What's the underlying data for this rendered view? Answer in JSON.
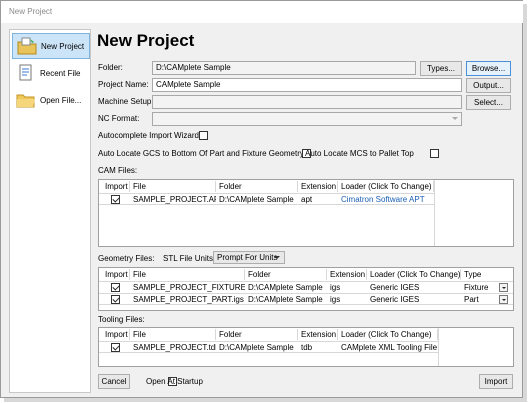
{
  "window": {
    "title": "New Project"
  },
  "sidebar": {
    "items": [
      {
        "label": "New Project"
      },
      {
        "label": "Recent File"
      },
      {
        "label": "Open File..."
      }
    ]
  },
  "page": {
    "heading": "New Project"
  },
  "form": {
    "folder_label": "Folder:",
    "folder_value": "D:\\CAMplete Sample",
    "types_button": "Types...",
    "browse_button": "Browse...",
    "project_name_label": "Project Name:",
    "project_name_value": "CAMplete Sample",
    "output_button": "Output...",
    "machine_setup_label": "Machine Setup:",
    "machine_setup_value": "",
    "select_button": "Select...",
    "nc_format_label": "NC Format:",
    "nc_format_value": "",
    "autocomplete_label": "Autocomplete Import Wizard",
    "auto_gcs_label": "Auto Locate GCS to Bottom Of Part and Fixture Geometry",
    "auto_mcs_label": "Auto Locate MCS to Pallet Top"
  },
  "cam": {
    "title": "CAM Files:",
    "headers": [
      "Import",
      "File",
      "Folder",
      "Extension",
      "Loader (Click To Change)"
    ],
    "rows": [
      {
        "file": "SAMPLE_PROJECT.APT",
        "folder": "D:\\CAMplete Sample",
        "ext": "apt",
        "loader": "Cimatron Software APT"
      }
    ]
  },
  "geometry": {
    "title": "Geometry Files:",
    "stl_label": "STL File Units:",
    "stl_value": "Prompt For Units",
    "headers": [
      "Import",
      "File",
      "Folder",
      "Extension",
      "Loader (Click To Change)",
      "Type"
    ],
    "rows": [
      {
        "file": "SAMPLE_PROJECT_FIXTURE.igs",
        "folder": "D:\\CAMplete Sample",
        "ext": "igs",
        "loader": "Generic IGES",
        "type": "Fixture"
      },
      {
        "file": "SAMPLE_PROJECT_PART.igs",
        "folder": "D:\\CAMplete Sample",
        "ext": "igs",
        "loader": "Generic IGES",
        "type": "Part"
      }
    ]
  },
  "tooling": {
    "title": "Tooling Files:",
    "headers": [
      "Import",
      "File",
      "Folder",
      "Extension",
      "Loader (Click To Change)"
    ],
    "rows": [
      {
        "file": "SAMPLE_PROJECT.tdb",
        "folder": "D:\\CAMplete Sample",
        "ext": "tdb",
        "loader": "CAMplete XML Tooling File"
      }
    ]
  },
  "footer": {
    "cancel": "Cancel",
    "open_startup": "Open At Startup",
    "import": "Import"
  }
}
